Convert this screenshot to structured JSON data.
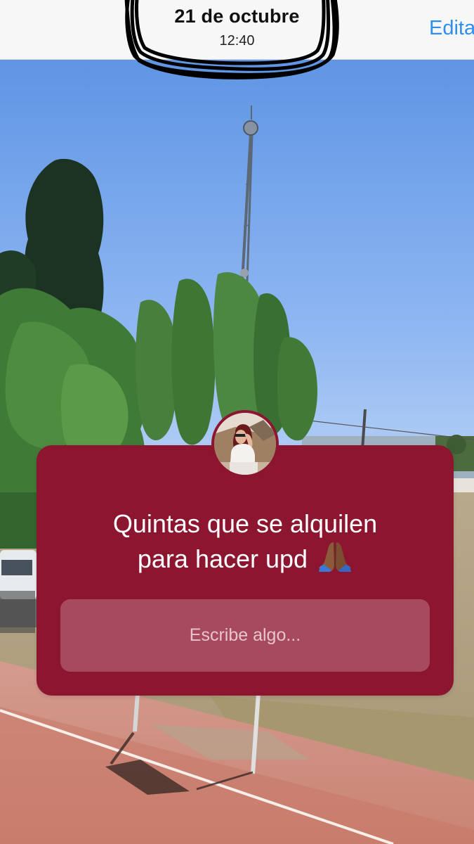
{
  "header": {
    "date": "21 de octubre",
    "time": "12:40",
    "edit_label": "Edita"
  },
  "question_sticker": {
    "question_line_1": "Quintas que se alquilen",
    "question_line_2": "para hacer upd",
    "emoji_icon": "folded-hands-icon",
    "answer_placeholder": "Escribe algo...",
    "background_color": "#8c1530"
  },
  "colors": {
    "edit_link": "#2f8ff0",
    "sky": "#8fb6f0"
  }
}
